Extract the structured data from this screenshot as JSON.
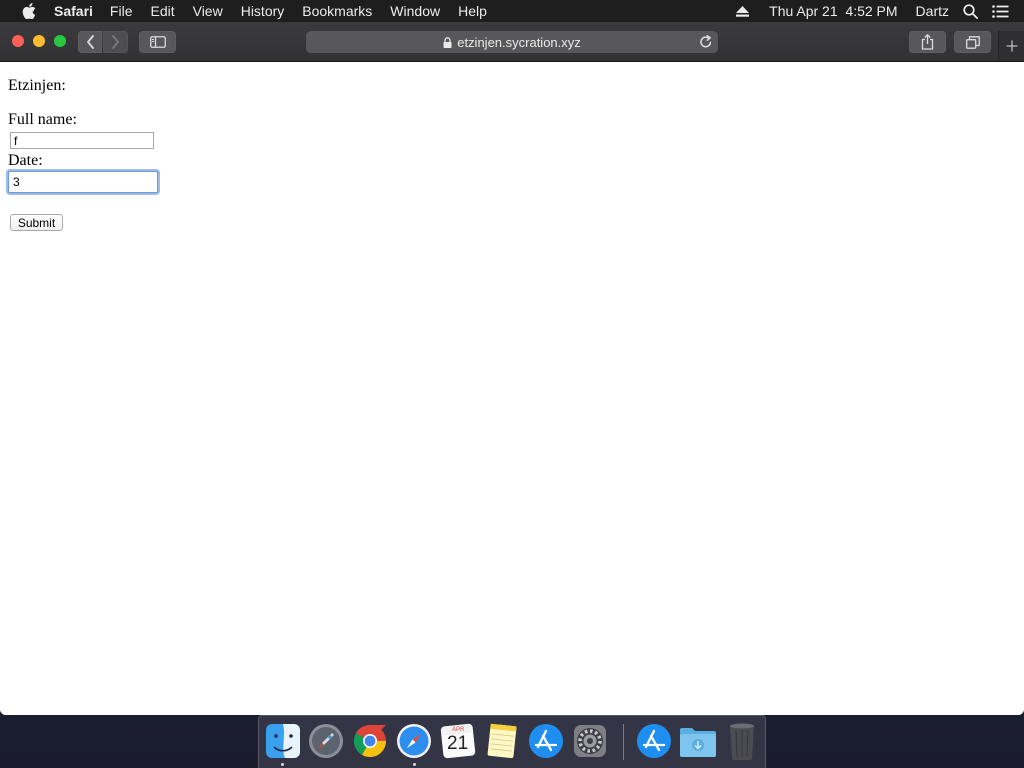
{
  "menubar": {
    "app_name": "Safari",
    "menus": [
      "File",
      "Edit",
      "View",
      "History",
      "Bookmarks",
      "Window",
      "Help"
    ],
    "clock": "Thu Apr 21  4:52 PM",
    "user": "Dartz",
    "icons": [
      "apple-icon",
      "eject-icon",
      "spotlight-search-icon",
      "notification-center-icon"
    ]
  },
  "browser": {
    "url": "etzinjen.sycration.xyz",
    "secure": true,
    "toolbar_icons": [
      "back-icon",
      "forward-icon",
      "sidebar-icon",
      "lock-icon",
      "reload-icon",
      "share-icon",
      "tabs-overview-icon",
      "new-tab-icon"
    ]
  },
  "form": {
    "heading": "Etzinjen:",
    "full_name_label": "Full name:",
    "full_name_value": "f",
    "date_label": "Date:",
    "date_value": "3",
    "submit_label": "Submit"
  },
  "dock": {
    "items": [
      {
        "name": "Finder",
        "icon": "finder-icon",
        "running": true
      },
      {
        "name": "Launchpad",
        "icon": "launchpad-icon",
        "running": false
      },
      {
        "name": "Google Chrome",
        "icon": "chrome-icon",
        "running": false
      },
      {
        "name": "Safari",
        "icon": "safari-icon",
        "running": true
      },
      {
        "name": "Calendar",
        "icon": "calendar-icon",
        "running": false,
        "month": "APR",
        "day": "21"
      },
      {
        "name": "Notes",
        "icon": "notes-icon",
        "running": false
      },
      {
        "name": "App Store",
        "icon": "app-store-icon",
        "running": false
      },
      {
        "name": "System Preferences",
        "icon": "system-preferences-icon",
        "running": false
      },
      {
        "name": "Applications",
        "icon": "applications-folder-icon",
        "running": false
      },
      {
        "name": "Downloads",
        "icon": "downloads-folder-icon",
        "running": false
      },
      {
        "name": "Trash",
        "icon": "trash-icon",
        "running": false
      }
    ]
  }
}
